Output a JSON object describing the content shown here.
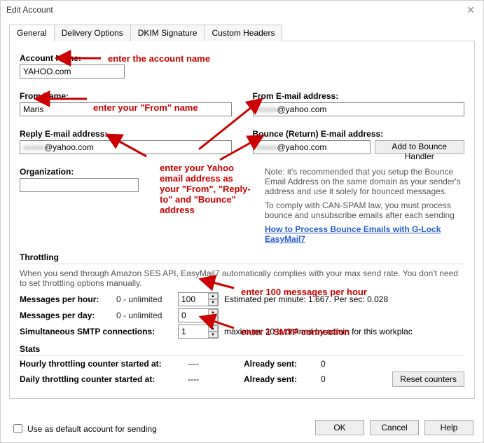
{
  "window": {
    "title": "Edit Account"
  },
  "tabs": [
    {
      "label": "General"
    },
    {
      "label": "Delivery Options"
    },
    {
      "label": "DKIM Signature"
    },
    {
      "label": "Custom Headers"
    }
  ],
  "labels": {
    "account_name": "Account Name:",
    "from_name": "From Name:",
    "from_email": "From E-mail address:",
    "reply_email": "Reply E-mail address:",
    "bounce_email": "Bounce (Return) E-mail address:",
    "organization": "Organization:",
    "throttling": "Throttling",
    "msg_hour": "Messages per hour:",
    "msg_day": "Messages per day:",
    "simul": "Simultaneous SMTP connections:",
    "unlimited": "0 - unlimited",
    "est": "Estimated per minute: 1.667. Per sec: 0.028",
    "max": "maximum: 20 is defined by admin for this workplac",
    "stats": "Stats",
    "hourly": "Hourly throttling counter started at:",
    "daily": "Daily throttling counter started at:",
    "already": "Already sent:",
    "dashes": "----"
  },
  "values": {
    "account_name": "YAHOO.com",
    "from_name": "Maris",
    "from_email_pre": "xxxxx",
    "from_email_suf": "@yahoo.com",
    "reply_email_pre": "xxxxx",
    "reply_email_suf": "@yahoo.com",
    "bounce_email_pre": "xxxxx",
    "bounce_email_suf": "@yahoo.com",
    "organization": "",
    "msg_hour": "100",
    "msg_day": "0",
    "simul": "1",
    "already_h": "0",
    "already_d": "0"
  },
  "notes": {
    "bounce": "Note: it's recommended that you setup the Bounce Email Address on the same domain as your sender's address and use it solely for bounced messages.",
    "canspam": "To comply with CAN-SPAM law, you must process bounce and unsubscribe emails after each sending",
    "link": "How to Process Bounce Emails with G-Lock EasyMail7",
    "throttle": "When you send through Amazon SES API, EasyMail7 automatically complies with your max send rate. You don't need to set throttling options manually."
  },
  "buttons": {
    "add_bounce": "Add to Bounce Handler",
    "reset": "Reset counters",
    "ok": "OK",
    "cancel": "Cancel",
    "help": "Help"
  },
  "footer": {
    "default": "Use as default account for sending"
  },
  "annotations": {
    "acct": "enter the account name",
    "from": "enter your \"From\" name",
    "yahoo": "enter your Yahoo email address as your \"From\", \"Reply-to\" and \"Bounce\" address",
    "msg100": "enter 100 messages per hour",
    "smtp1": "enter 1 SMTP connection"
  }
}
